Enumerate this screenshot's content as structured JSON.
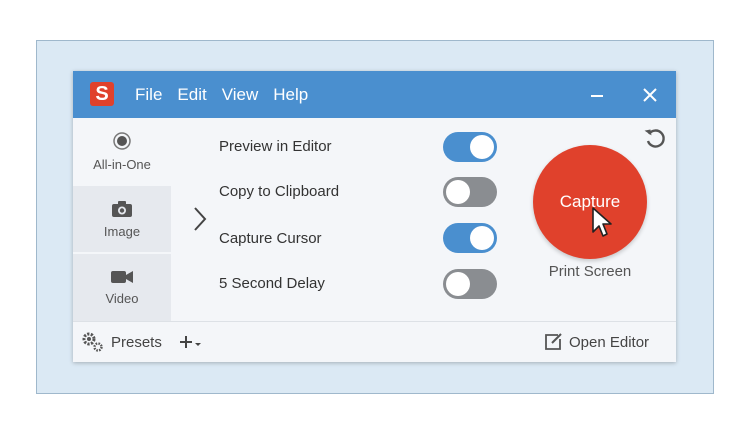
{
  "app": {
    "logo_letter": "S",
    "menu": [
      "File",
      "Edit",
      "View",
      "Help"
    ]
  },
  "sidebar": {
    "items": [
      {
        "label": "All-in-One",
        "icon": "radio-dot-icon",
        "selected": true
      },
      {
        "label": "Image",
        "icon": "camera-icon",
        "selected": false
      },
      {
        "label": "Video",
        "icon": "video-camera-icon",
        "selected": false
      }
    ]
  },
  "options": [
    {
      "label": "Preview in Editor",
      "on": true
    },
    {
      "label": "Copy to Clipboard",
      "on": false
    },
    {
      "label": "Capture Cursor",
      "on": true
    },
    {
      "label": "5 Second Delay",
      "on": false
    }
  ],
  "capture": {
    "label": "Capture",
    "hotkey": "Print Screen"
  },
  "footer": {
    "presets_label": "Presets",
    "open_editor_label": "Open Editor"
  },
  "colors": {
    "titlebar": "#4a8fcf",
    "capture": "#e0412c",
    "toggle_on": "#4a8fcf",
    "toggle_off": "#8a8d91",
    "frame_bg": "#dbe9f4"
  }
}
